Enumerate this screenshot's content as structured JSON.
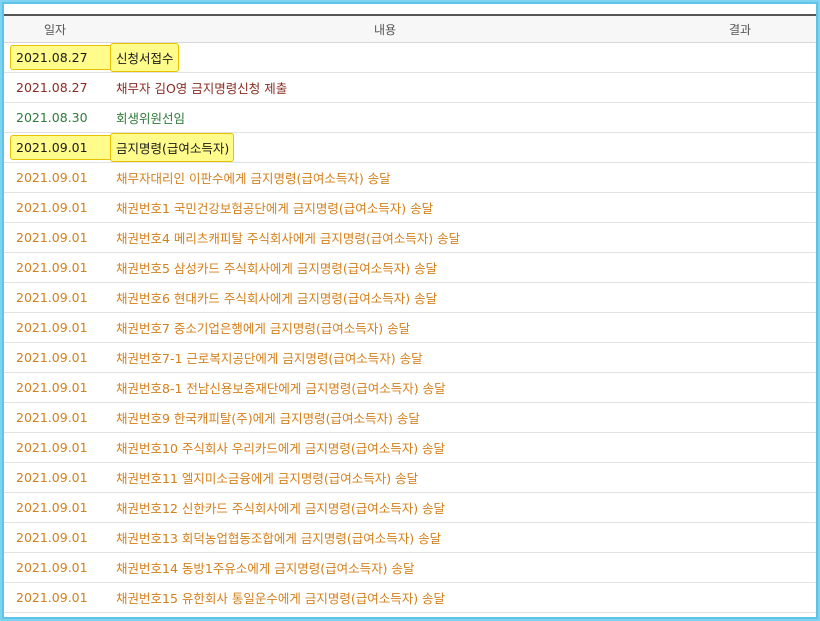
{
  "headers": {
    "date": "일자",
    "content": "내용",
    "result": "결과"
  },
  "colors": {
    "black": "#1a1a1a",
    "maroon": "#8a2b22",
    "green": "#2f7a3a",
    "orange": "#d4801c",
    "highlight": "#fffc8c"
  },
  "rows": [
    {
      "date": "2021.08.27",
      "content": "신청서접수",
      "result": ""
    },
    {
      "date": "2021.08.27",
      "content": "채무자 김O영 금지명령신청 제출",
      "result": ""
    },
    {
      "date": "2021.08.30",
      "content": "회생위원선임",
      "result": ""
    },
    {
      "date": "2021.09.01",
      "content": "금지명령(급여소득자)",
      "result": ""
    },
    {
      "date": "2021.09.01",
      "content": "채무자대리인 이판수에게 금지명령(급여소득자) 송달",
      "result": ""
    },
    {
      "date": "2021.09.01",
      "content": "채권번호1 국민건강보험공단에게 금지명령(급여소득자) 송달",
      "result": ""
    },
    {
      "date": "2021.09.01",
      "content": "채권번호4 메리츠캐피탈 주식회사에게 금지명령(급여소득자) 송달",
      "result": ""
    },
    {
      "date": "2021.09.01",
      "content": "채권번호5 삼성카드 주식회사에게 금지명령(급여소득자) 송달",
      "result": ""
    },
    {
      "date": "2021.09.01",
      "content": "채권번호6 현대카드 주식회사에게 금지명령(급여소득자) 송달",
      "result": ""
    },
    {
      "date": "2021.09.01",
      "content": "채권번호7 중소기업은행에게 금지명령(급여소득자) 송달",
      "result": ""
    },
    {
      "date": "2021.09.01",
      "content": "채권번호7-1 근로복지공단에게 금지명령(급여소득자) 송달",
      "result": ""
    },
    {
      "date": "2021.09.01",
      "content": "채권번호8-1 전남신용보증재단에게 금지명령(급여소득자) 송달",
      "result": ""
    },
    {
      "date": "2021.09.01",
      "content": "채권번호9 한국캐피탈(주)에게 금지명령(급여소득자) 송달",
      "result": ""
    },
    {
      "date": "2021.09.01",
      "content": "채권번호10 주식회사 우리카드에게 금지명령(급여소득자) 송달",
      "result": ""
    },
    {
      "date": "2021.09.01",
      "content": "채권번호11 엘지미소금융에게 금지명령(급여소득자) 송달",
      "result": ""
    },
    {
      "date": "2021.09.01",
      "content": "채권번호12 신한카드 주식회사에게 금지명령(급여소득자) 송달",
      "result": ""
    },
    {
      "date": "2021.09.01",
      "content": "채권번호13 회덕농업협동조합에게 금지명령(급여소득자) 송달",
      "result": ""
    },
    {
      "date": "2021.09.01",
      "content": "채권번호14 동방1주유소에게 금지명령(급여소득자) 송달",
      "result": ""
    },
    {
      "date": "2021.09.01",
      "content": "채권번호15 유한회사 통일운수에게 금지명령(급여소득자) 송달",
      "result": ""
    }
  ]
}
